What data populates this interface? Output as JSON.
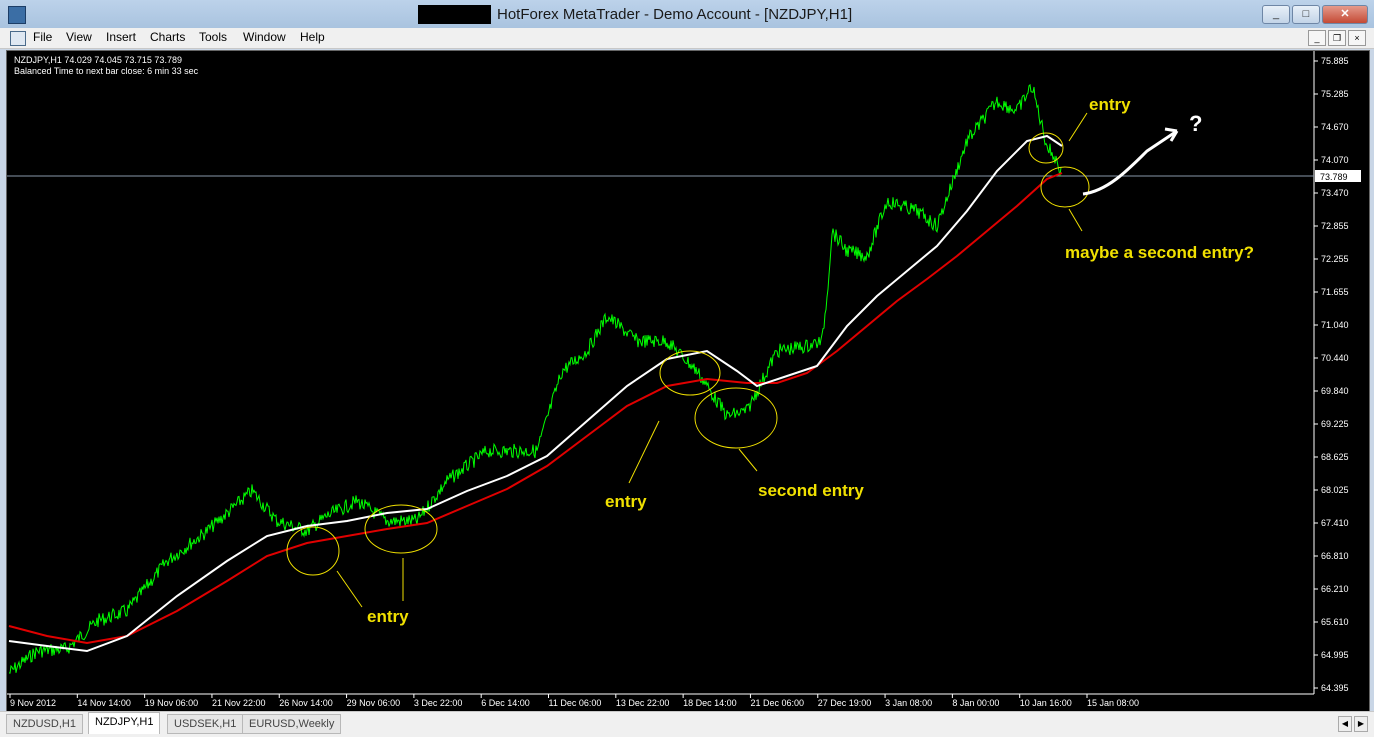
{
  "window": {
    "title": "HotForex MetaTrader - Demo Account - [NZDJPY,H1]",
    "minimize": "_",
    "maximize": "□",
    "close": "✕"
  },
  "menu": {
    "items": [
      "File",
      "View",
      "Insert",
      "Charts",
      "Tools",
      "Window",
      "Help"
    ],
    "mdi_min": "_",
    "mdi_restore": "❐",
    "mdi_close": "×"
  },
  "chart": {
    "info_line1": "NZDJPY,H1  74.029 74.045 73.715 73.789",
    "info_line2": "Balanced Time to next bar close: 6 min 33 sec",
    "current_price": "73.789",
    "price_ticks": [
      "75.885",
      "75.285",
      "74.670",
      "74.070",
      "73.470",
      "72.855",
      "72.255",
      "71.655",
      "71.040",
      "70.440",
      "69.840",
      "69.225",
      "68.625",
      "68.025",
      "67.410",
      "66.810",
      "66.210",
      "65.610",
      "64.995",
      "64.395"
    ],
    "time_ticks": [
      "9 Nov 2012",
      "14 Nov 14:00",
      "19 Nov 06:00",
      "21 Nov 22:00",
      "26 Nov 14:00",
      "29 Nov 06:00",
      "3 Dec 22:00",
      "6 Dec 14:00",
      "11 Dec 06:00",
      "13 Dec 22:00",
      "18 Dec 14:00",
      "21 Dec 06:00",
      "27 Dec 19:00",
      "3 Jan 08:00",
      "8 Jan 00:00",
      "10 Jan 16:00",
      "15 Jan 08:00"
    ],
    "annotations": {
      "entry1": "entry",
      "entry2": "entry",
      "second_entry": "second entry",
      "entry3": "entry",
      "maybe_second": "maybe a second entry?",
      "question": "?"
    },
    "colors": {
      "price": "#00ff00",
      "fast_ma": "#ffffff",
      "slow_ma": "#e00000",
      "annotation": "#f0e000",
      "background": "#000000"
    }
  },
  "tabs": [
    "NZDUSD,H1",
    "NZDJPY,H1",
    "USDSEK,H1",
    "EURUSD,Weekly"
  ],
  "tab_scroll_left": "◀",
  "tab_scroll_right": "▶"
}
